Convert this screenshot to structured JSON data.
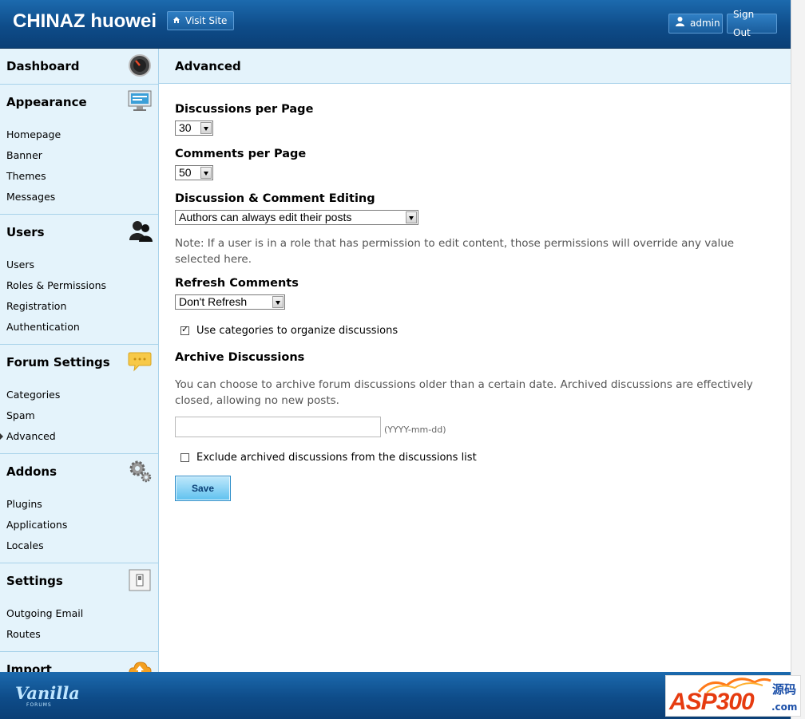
{
  "header": {
    "site_title": "CHINAZ huowei",
    "visit_site": "Visit Site",
    "admin": "admin",
    "sign_out": "Sign Out"
  },
  "sidebar": {
    "sections": [
      {
        "title": "Dashboard",
        "icon": "dashboard-icon",
        "items": []
      },
      {
        "title": "Appearance",
        "icon": "monitor-icon",
        "items": [
          "Homepage",
          "Banner",
          "Themes",
          "Messages"
        ]
      },
      {
        "title": "Users",
        "icon": "users-icon",
        "items": [
          "Users",
          "Roles & Permissions",
          "Registration",
          "Authentication"
        ]
      },
      {
        "title": "Forum Settings",
        "icon": "speech-bubble-icon",
        "items": [
          "Categories",
          "Spam",
          "Advanced"
        ]
      },
      {
        "title": "Addons",
        "icon": "gears-icon",
        "items": [
          "Plugins",
          "Applications",
          "Locales"
        ]
      },
      {
        "title": "Settings",
        "icon": "switch-icon",
        "items": [
          "Outgoing Email",
          "Routes"
        ]
      },
      {
        "title": "Import",
        "icon": "cloud-upload-icon",
        "items": []
      }
    ],
    "active_item": "Advanced"
  },
  "page": {
    "title": "Advanced",
    "discussions_per_page_label": "Discussions per Page",
    "discussions_per_page_value": "30",
    "comments_per_page_label": "Comments per Page",
    "comments_per_page_value": "50",
    "editing_label": "Discussion & Comment Editing",
    "editing_value": "Authors can always edit their posts",
    "editing_note": "Note: If a user is in a role that has permission to edit content, those permissions will override any value selected here.",
    "refresh_label": "Refresh Comments",
    "refresh_value": "Don't Refresh",
    "use_categories_label": "Use categories to organize discussions",
    "use_categories_checked": true,
    "archive_label": "Archive Discussions",
    "archive_note": "You can choose to archive forum discussions older than a certain date. Archived discussions are effectively closed, allowing no new posts.",
    "archive_date_value": "",
    "archive_date_hint": "(YYYY-mm-dd)",
    "exclude_archived_label": "Exclude archived discussions from the discussions list",
    "exclude_archived_checked": false,
    "save_label": "Save"
  },
  "footer": {
    "logo_text": "Vanilla",
    "logo_sub": "FORUMS",
    "watermark_text": "ASP300",
    "watermark_cn": "源码",
    "watermark_com": ".com"
  },
  "colors": {
    "header_blue": "#0e4c89",
    "sidebar_bg": "#e4f3fb",
    "border": "#a8d2ea",
    "save_button": "#5fc1ef"
  }
}
